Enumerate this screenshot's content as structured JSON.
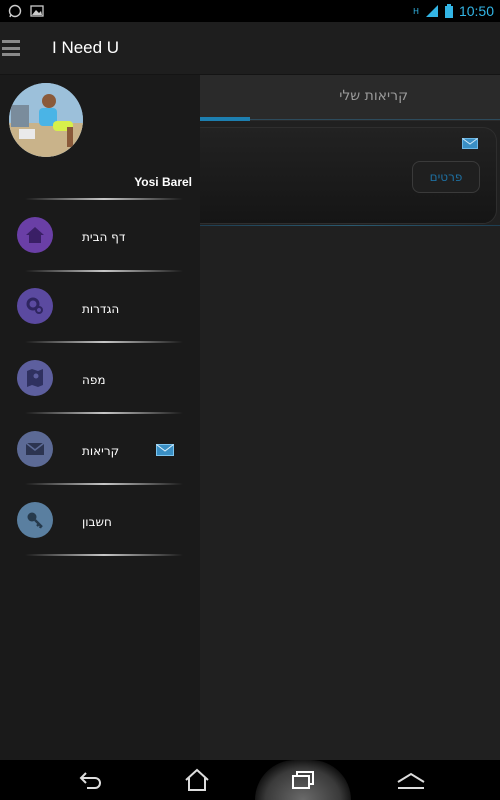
{
  "status_bar": {
    "time": "10:50",
    "network_label": "H"
  },
  "app_bar": {
    "title": "I Need U"
  },
  "main": {
    "tab_label": "קריאות שלי",
    "card": {
      "details_button": "פרטים"
    }
  },
  "drawer": {
    "user_name": "Yosi Barel",
    "items": [
      {
        "label": "דף הבית",
        "icon": "home-icon",
        "color": "#6a3fa6"
      },
      {
        "label": "הגדרות",
        "icon": "gear-icon",
        "color": "#5b4aa0"
      },
      {
        "label": "מפה",
        "icon": "map-icon",
        "color": "#5d5f9e"
      },
      {
        "label": "קריאות",
        "icon": "envelope-icon",
        "color": "#5c6a95"
      },
      {
        "label": "חשבון",
        "icon": "key-icon",
        "color": "#5a7fa0"
      }
    ]
  },
  "colors": {
    "accent": "#33b5e5",
    "tab_indicator": "#1d7fb0"
  }
}
